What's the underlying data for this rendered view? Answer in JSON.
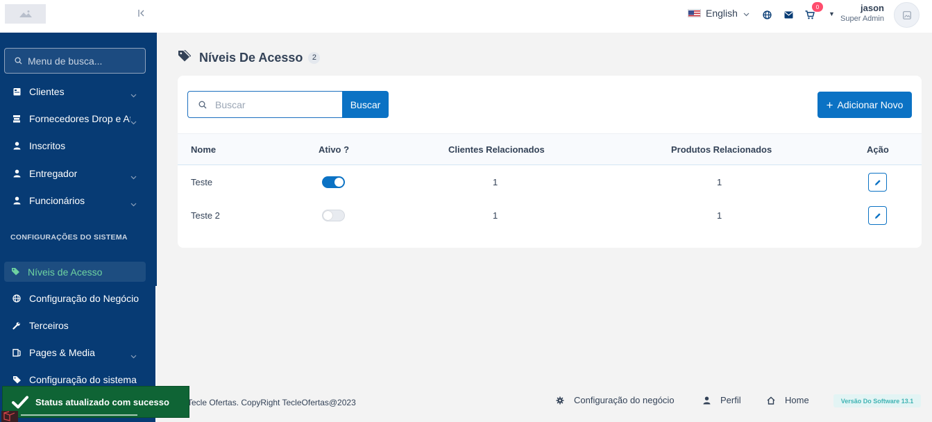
{
  "sidebar": {
    "search_placeholder": "Menu de busca...",
    "items": [
      {
        "label": "Clientes",
        "icon": "clipboard-icon",
        "has_chevron": true
      },
      {
        "label": "Fornecedores Drop e Atacado",
        "icon": "supplier-icon",
        "has_chevron": true
      },
      {
        "label": "Inscritos",
        "icon": "user-icon",
        "has_chevron": false
      },
      {
        "label": "Entregador",
        "icon": "user-icon",
        "has_chevron": true
      },
      {
        "label": "Funcionários",
        "icon": "user-icon",
        "has_chevron": true
      }
    ],
    "section_title": "CONFIGURAÇÕES DO SISTEMA",
    "active_item": {
      "label": "Níveis de Acesso",
      "icon": "tag-icon"
    },
    "items_bottom": [
      {
        "label": "Configuração do Negócio",
        "icon": "globe-icon",
        "has_chevron": false
      },
      {
        "label": "Terceiros",
        "icon": "wrench-icon",
        "has_chevron": false
      },
      {
        "label": "Pages & Media",
        "icon": "pages-icon",
        "has_chevron": true
      },
      {
        "label": "Configuração do sistema",
        "icon": "tag-icon",
        "has_chevron": false
      }
    ]
  },
  "header": {
    "language": "English",
    "cart_count": "0",
    "user_name": "jason",
    "user_role": "Super Admin"
  },
  "main": {
    "title": "Níveis De Acesso",
    "count": "2",
    "search_placeholder": "Buscar",
    "search_button": "Buscar",
    "add_button": "Adicionar Novo",
    "columns": [
      "Nome",
      "Ativo ?",
      "Clientes Relacionados",
      "Produtos Relacionados",
      "Ação"
    ],
    "rows": [
      {
        "name": "Teste",
        "active": true,
        "clients": "1",
        "products": "1"
      },
      {
        "name": "Teste 2",
        "active": false,
        "clients": "1",
        "products": "1"
      }
    ]
  },
  "footer": {
    "copyright": "Tecle Ofertas. CopyRight TecleOfertas@2023",
    "links": [
      "Configuração do negócio",
      "Perfil",
      "Home"
    ],
    "version": "Versão Do Software 13.1"
  },
  "toast": {
    "message": "Status atualizado com sucesso"
  },
  "colors": {
    "sidebar_bg": "#073b74",
    "primary": "#0b72c4",
    "active_text": "#6ed2a0",
    "toast_bg": "#0f6435",
    "badge": "#ff4d6d"
  }
}
